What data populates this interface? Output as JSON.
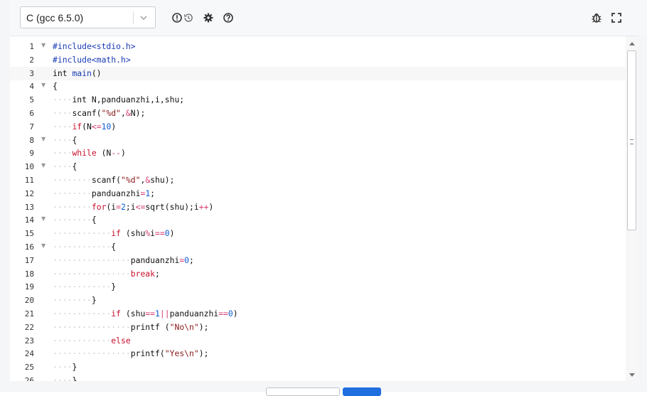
{
  "toolbar": {
    "language": "C (gcc 6.5.0)",
    "icons": [
      "warning-circle-icon",
      "history-icon",
      "settings-gear-icon",
      "help-icon",
      "debug-bug-icon",
      "fullscreen-icon"
    ]
  },
  "editor": {
    "lines": [
      {
        "n": "1",
        "fold": true
      },
      {
        "n": "2"
      },
      {
        "n": "3"
      },
      {
        "n": "4",
        "fold": true
      },
      {
        "n": "5"
      },
      {
        "n": "6"
      },
      {
        "n": "7"
      },
      {
        "n": "8",
        "fold": true
      },
      {
        "n": "9"
      },
      {
        "n": "10",
        "fold": true
      },
      {
        "n": "11"
      },
      {
        "n": "12"
      },
      {
        "n": "13"
      },
      {
        "n": "14",
        "fold": true
      },
      {
        "n": "15"
      },
      {
        "n": "16",
        "fold": true
      },
      {
        "n": "17"
      },
      {
        "n": "18"
      },
      {
        "n": "19"
      },
      {
        "n": "20"
      },
      {
        "n": "21"
      },
      {
        "n": "22"
      },
      {
        "n": "23"
      },
      {
        "n": "24"
      },
      {
        "n": "25"
      },
      {
        "n": "26"
      }
    ],
    "code": [
      "#include<stdio.h>",
      "#include<math.h>",
      "int main()",
      "{",
      "    int N,panduanzhi,i,shu;",
      "    scanf(\"%d\",&N);",
      "    if(N<=10)",
      "    {",
      "    while (N--)",
      "    {",
      "        scanf(\"%d\",&shu);",
      "        panduanzhi=1;",
      "        for(i=2;i<=sqrt(shu);i++)",
      "        {",
      "            if (shu%i==0)",
      "            {",
      "                panduanzhi=0;",
      "                break;",
      "            }",
      "        }",
      "            if (shu==1||panduanzhi==0)",
      "                printf (\"No\\n\");",
      "            else",
      "                printf(\"Yes\\n\");",
      "    }",
      "    }"
    ]
  },
  "colors": {
    "keyword": "#c8102e",
    "preprocessor": "#1a3bb3",
    "number": "#0d5bd1",
    "string": "#8b1a1a",
    "accent": "#1f6fe0"
  }
}
